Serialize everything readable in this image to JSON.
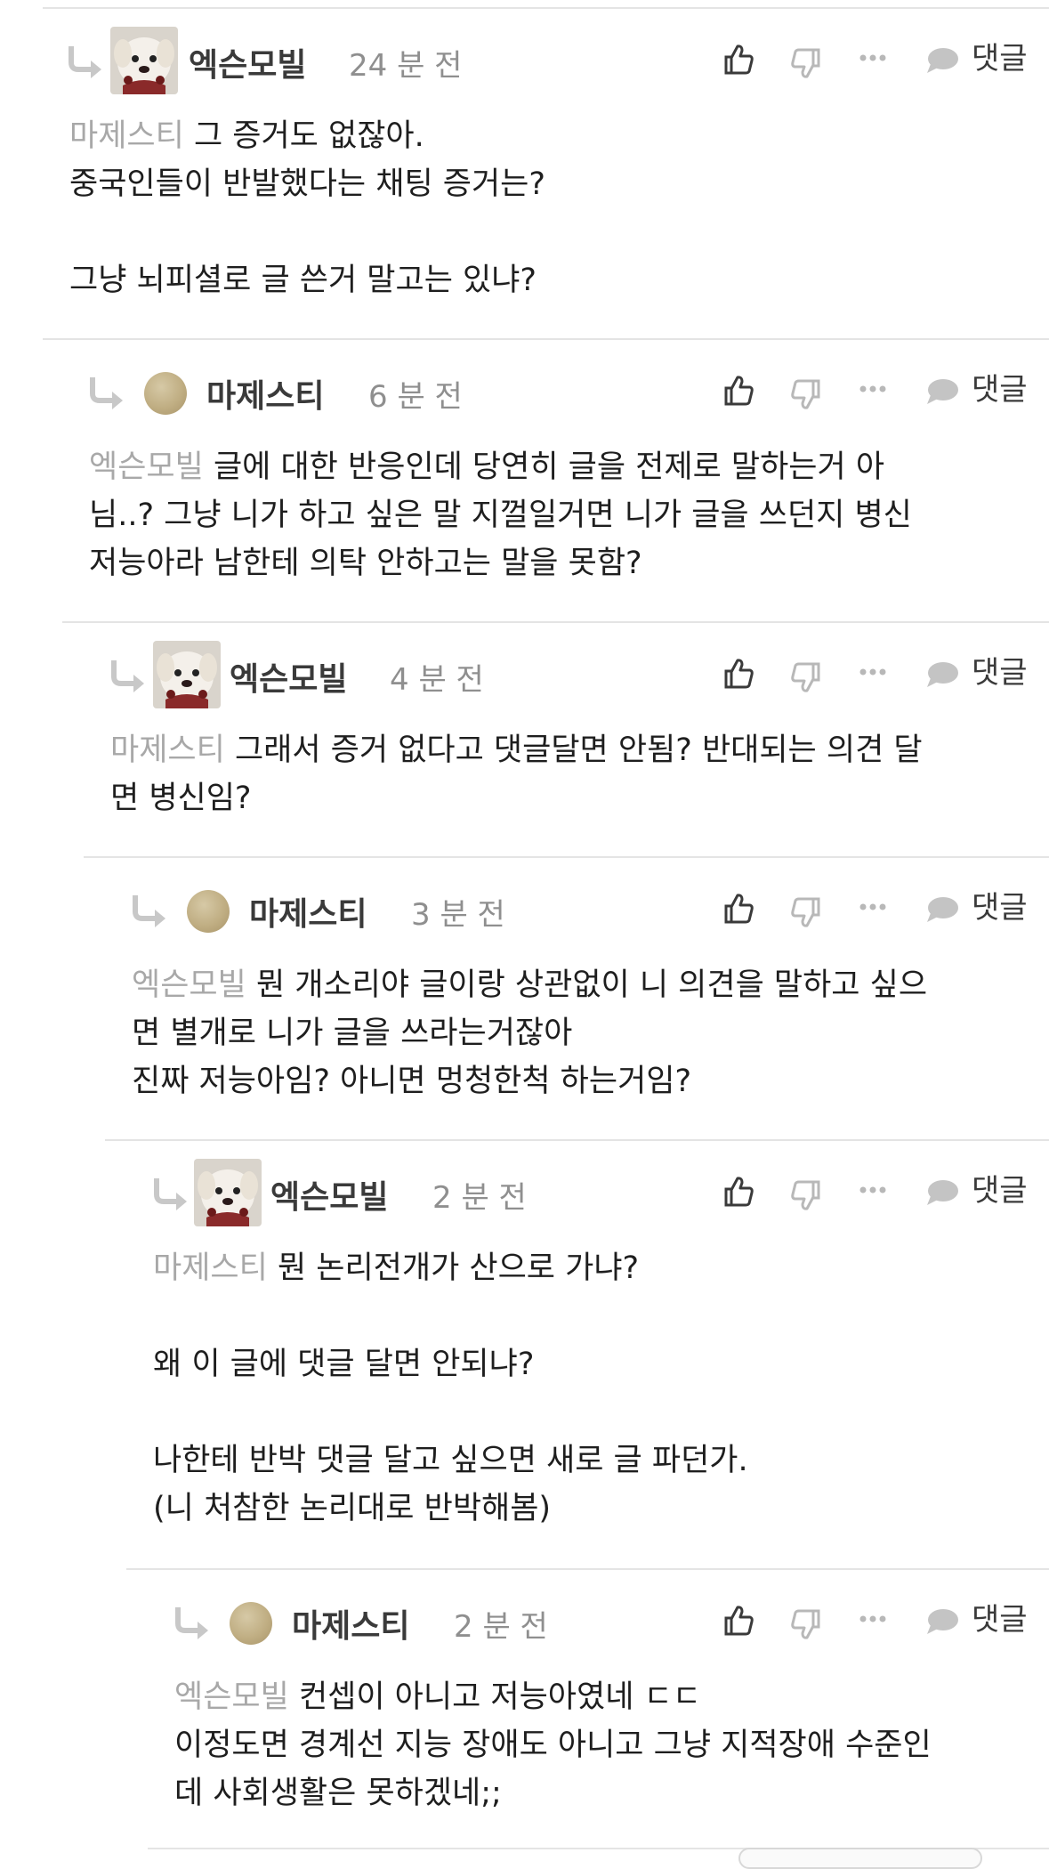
{
  "comments": [
    {
      "author": "엑슨모빌",
      "avatar": "dog-avatar",
      "time": "24 분 전",
      "reply_label": "댓글",
      "mention": "마제스티",
      "text": " 그 증거도 없잖아.\n중국인들이 반발했다는 채팅 증거는?\n\n그냥 뇌피셜로 글 쓴거 말고는 있냐?"
    },
    {
      "author": "마제스티",
      "avatar": "plain-circle-avatar",
      "time": "6 분 전",
      "reply_label": "댓글",
      "mention": "엑슨모빌",
      "text": " 글에 대한 반응인데 당연히 글을 전제로 말하는거 아\n님..? 그냥 니가 하고 싶은 말 지껄일거면 니가 글을 쓰던지 병신\n저능아라 남한테 의탁 안하고는 말을 못함?"
    },
    {
      "author": "엑슨모빌",
      "avatar": "dog-avatar",
      "time": "4 분 전",
      "reply_label": "댓글",
      "mention": "마제스티",
      "text": " 그래서 증거 없다고 댓글달면 안됨? 반대되는 의견 달\n면 병신임?"
    },
    {
      "author": "마제스티",
      "avatar": "plain-circle-avatar",
      "time": "3 분 전",
      "reply_label": "댓글",
      "mention": "엑슨모빌",
      "text": " 뭔 개소리야 글이랑 상관없이 니 의견을 말하고 싶으\n면 별개로 니가 글을 쓰라는거잖아\n진짜 저능아임? 아니면 멍청한척 하는거임?"
    },
    {
      "author": "엑슨모빌",
      "avatar": "dog-avatar",
      "time": "2 분 전",
      "reply_label": "댓글",
      "mention": "마제스티",
      "text": " 뭔 논리전개가 산으로 가냐?\n\n왜 이 글에 댓글 달면 안되냐?\n\n나한테 반박 댓글 달고 싶으면 새로 글 파던가.\n(니 처참한 논리대로 반박해봄)"
    },
    {
      "author": "마제스티",
      "avatar": "plain-circle-avatar",
      "time": "2 분 전",
      "reply_label": "댓글",
      "mention": "엑슨모빌",
      "text": " 컨셉이 아니고 저능아였네 ㄷㄷ\n이정도면 경계선 지능 장애도 아니고 그냥 지적장애 수준인\n데 사회생활은 못하겠네;;"
    }
  ],
  "icons": {
    "like": "thumbs-up-icon",
    "dislike": "thumbs-down-icon",
    "more": "more-dots-icon",
    "reply": "speech-bubble-icon",
    "reply_arrow": "reply-arrow-icon"
  },
  "colors": {
    "text": "#1e1e1e",
    "author": "#3a3a3a",
    "muted": "#8f8f8f",
    "mention": "#a8a8a8",
    "icon_active": "#3a3a3a",
    "icon_muted": "#b8b8b8",
    "divider": "#e4e4e4"
  }
}
